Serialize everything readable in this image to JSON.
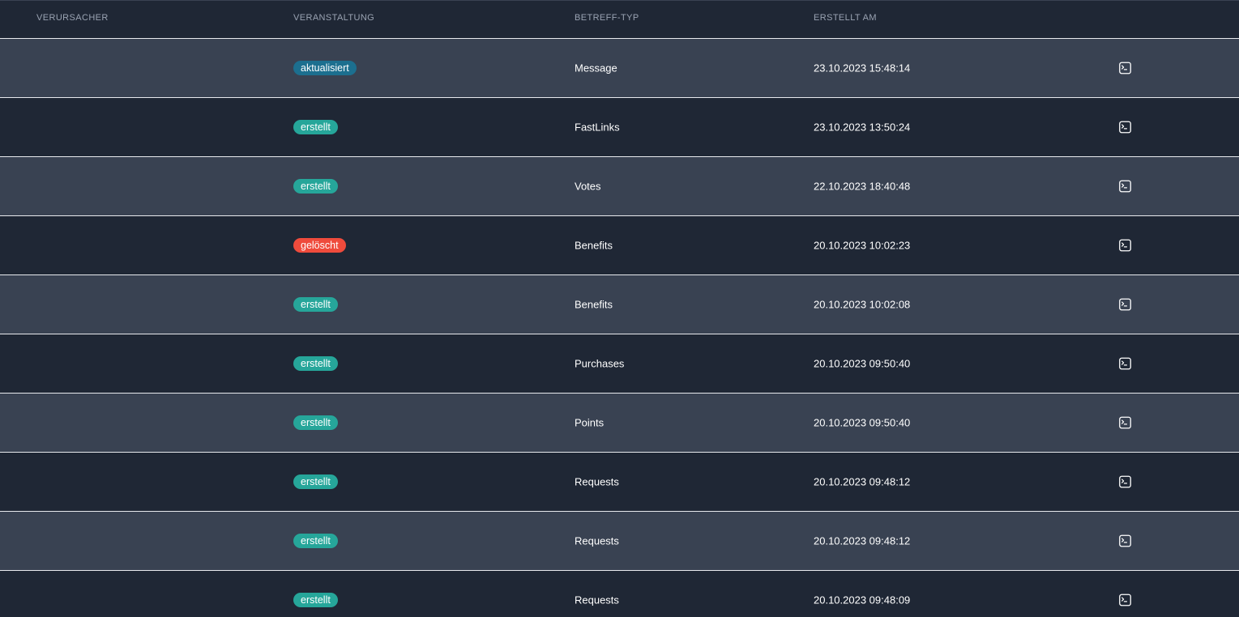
{
  "columns": {
    "verursacher": "VERURSACHER",
    "veranstaltung": "VERANSTALTUNG",
    "betreff_typ": "BETREFF-TYP",
    "erstellt_am": "ERSTELLT AM"
  },
  "colors": {
    "aktualisiert": "#1c6f8f",
    "erstellt": "#26a69a",
    "gelöscht": "#ef4b3c"
  },
  "row_icon": "terminal-icon",
  "rows": [
    {
      "verursacher": "",
      "veranstaltung": "aktualisiert",
      "status": "aktualisiert",
      "betreff_typ": "Message",
      "erstellt_am": "23.10.2023 15:48:14"
    },
    {
      "verursacher": "",
      "veranstaltung": "erstellt",
      "status": "erstellt",
      "betreff_typ": "FastLinks",
      "erstellt_am": "23.10.2023 13:50:24"
    },
    {
      "verursacher": "",
      "veranstaltung": "erstellt",
      "status": "erstellt",
      "betreff_typ": "Votes",
      "erstellt_am": "22.10.2023 18:40:48"
    },
    {
      "verursacher": "",
      "veranstaltung": "gelöscht",
      "status": "gelöscht",
      "betreff_typ": "Benefits",
      "erstellt_am": "20.10.2023 10:02:23"
    },
    {
      "verursacher": "",
      "veranstaltung": "erstellt",
      "status": "erstellt",
      "betreff_typ": "Benefits",
      "erstellt_am": "20.10.2023 10:02:08"
    },
    {
      "verursacher": "",
      "veranstaltung": "erstellt",
      "status": "erstellt",
      "betreff_typ": "Purchases",
      "erstellt_am": "20.10.2023 09:50:40"
    },
    {
      "verursacher": "",
      "veranstaltung": "erstellt",
      "status": "erstellt",
      "betreff_typ": "Points",
      "erstellt_am": "20.10.2023 09:50:40"
    },
    {
      "verursacher": "",
      "veranstaltung": "erstellt",
      "status": "erstellt",
      "betreff_typ": "Requests",
      "erstellt_am": "20.10.2023 09:48:12"
    },
    {
      "verursacher": "",
      "veranstaltung": "erstellt",
      "status": "erstellt",
      "betreff_typ": "Requests",
      "erstellt_am": "20.10.2023 09:48:12"
    },
    {
      "verursacher": "",
      "veranstaltung": "erstellt",
      "status": "erstellt",
      "betreff_typ": "Requests",
      "erstellt_am": "20.10.2023 09:48:09"
    }
  ]
}
